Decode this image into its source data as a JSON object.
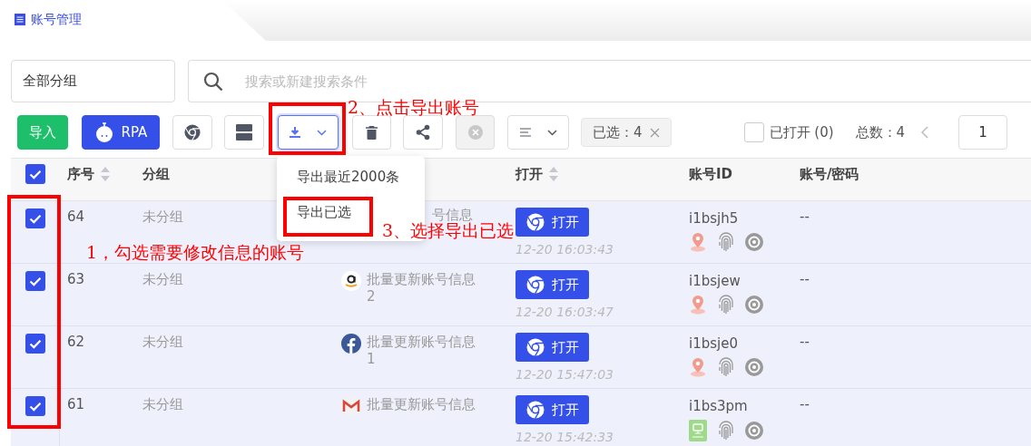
{
  "header": {
    "title": "账号管理"
  },
  "filters": {
    "group": "全部分组",
    "search": {
      "placeholder": "搜索或新建搜索条件"
    }
  },
  "toolbar": {
    "import_label": "导入",
    "rpa_label": "RPA",
    "selected_chip": "已选：4",
    "opened_filter": {
      "label": "已打开 (0)",
      "checked": false
    },
    "total": "总数：4",
    "page": "1"
  },
  "export_menu": {
    "items": [
      "导出最近2000条",
      "导出已选"
    ]
  },
  "table": {
    "all_checked": true,
    "columns": [
      {
        "label": "序号",
        "sortable": true
      },
      {
        "label": "分组",
        "sortable": false
      },
      {
        "label": "打开",
        "sortable": true
      },
      {
        "label": "账号ID",
        "sortable": false
      },
      {
        "label": "账号/密码",
        "sortable": false
      }
    ],
    "rows": [
      {
        "checked": true,
        "seq": "64",
        "group": "未分组",
        "name": [
          "号信息"
        ],
        "open_label": "打开",
        "time": "12-20 16:03:43",
        "id": "i1bsjh5",
        "proxy": {
          "kind": "location"
        },
        "credentials": "--"
      },
      {
        "checked": true,
        "seq": "63",
        "group": "未分组",
        "platform": {
          "kind": "amazon"
        },
        "name": [
          "批量更新账号信息",
          "2"
        ],
        "open_label": "打开",
        "time": "12-20 16:03:47",
        "id": "i1bsjew",
        "proxy": {
          "kind": "location"
        },
        "credentials": "--"
      },
      {
        "checked": true,
        "seq": "62",
        "group": "未分组",
        "platform": {
          "kind": "facebook"
        },
        "name": [
          "批量更新账号信息",
          "1"
        ],
        "open_label": "打开",
        "time": "12-20 15:47:03",
        "id": "i1bsje0",
        "proxy": {
          "kind": "location"
        },
        "credentials": "--"
      },
      {
        "checked": true,
        "seq": "61",
        "group": "未分组",
        "platform": {
          "kind": "gmail"
        },
        "name": [
          "批量更新账号信息"
        ],
        "open_label": "打开",
        "time": "12-20 15:42:33",
        "id": "i1bs3pm",
        "proxy": {
          "kind": "device"
        },
        "credentials": "--"
      }
    ]
  },
  "annotations": [
    {
      "kind": "box"
    },
    {
      "kind": "box"
    },
    {
      "kind": "box"
    },
    {
      "kind": "text",
      "text": "1，勾选需要修改信息的账号"
    },
    {
      "kind": "text",
      "text": "2、点击导出账号"
    },
    {
      "kind": "text",
      "text": "3、选择导出已选"
    }
  ]
}
